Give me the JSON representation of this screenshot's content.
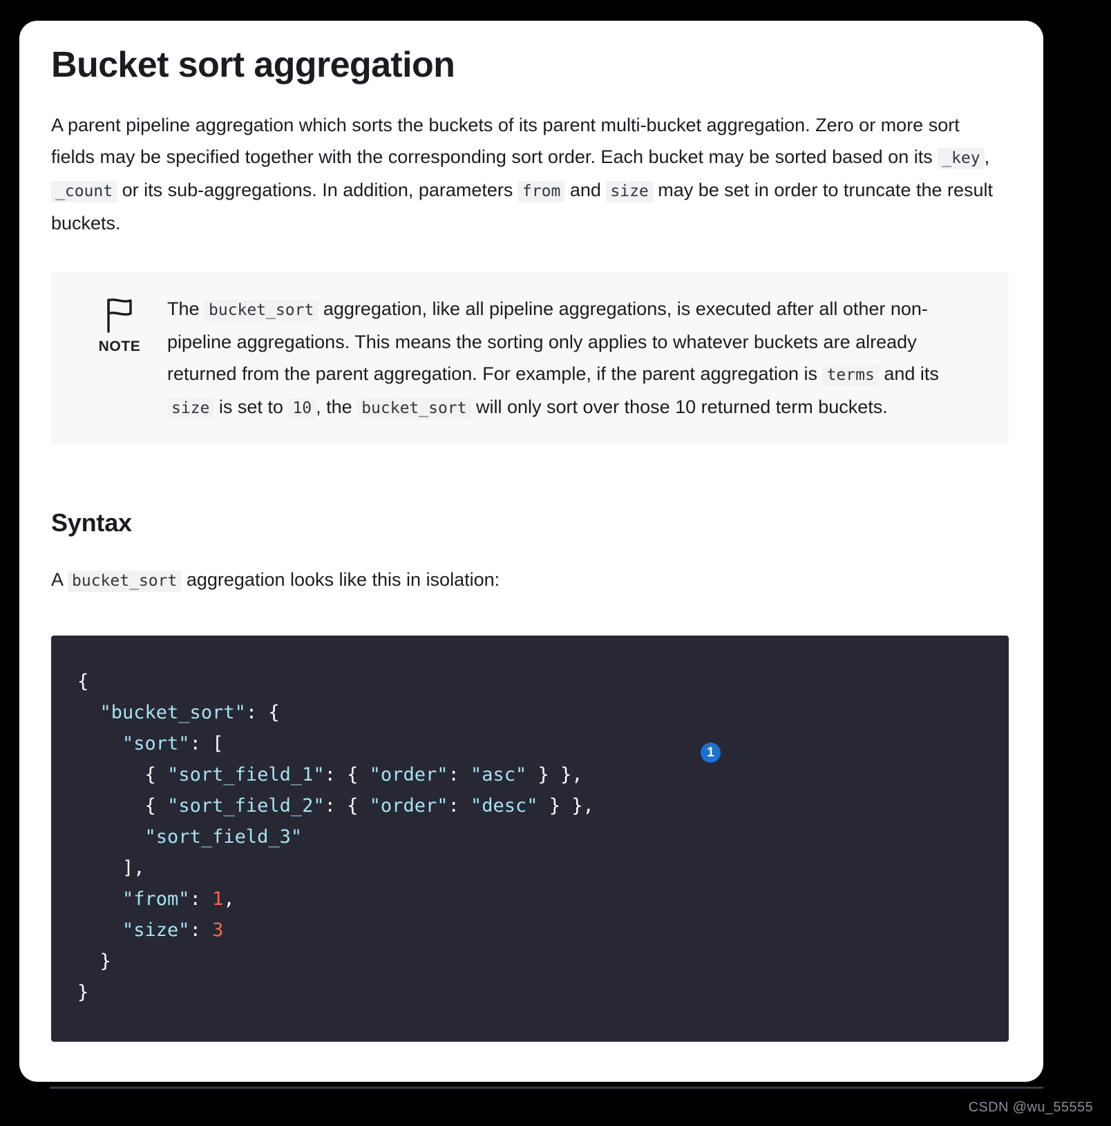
{
  "page": {
    "title": "Bucket sort aggregation"
  },
  "intro": {
    "seg1": "A parent pipeline aggregation which sorts the buckets of its parent multi-bucket aggregation. Zero or more sort fields may be specified together with the corresponding sort order. Each bucket may be sorted based on its ",
    "code1": "_key",
    "seg2": ", ",
    "code2": "_count",
    "seg3": " or its sub-aggregations. In addition, parameters ",
    "code3": "from",
    "seg4": " and ",
    "code4": "size",
    "seg5": " may be set in order to truncate the result buckets."
  },
  "note": {
    "icon": "flag-icon",
    "label": "NOTE",
    "seg1": "The ",
    "code1": "bucket_sort",
    "seg2": " aggregation, like all pipeline aggregations, is executed after all other non-pipeline aggregations. This means the sorting only applies to whatever buckets are already returned from the parent aggregation. For example, if the parent aggregation is ",
    "code2": "terms",
    "seg3": " and its ",
    "code3": "size",
    "seg4": " is set to ",
    "code4": "10",
    "seg5": ", the ",
    "code5": "bucket_sort",
    "seg6": " will only sort over those 10 returned term buckets."
  },
  "syntax": {
    "heading": "Syntax",
    "lead_seg1": "A ",
    "lead_code": "bucket_sort",
    "lead_seg2": " aggregation looks like this in isolation:"
  },
  "code_block": {
    "language": "json",
    "callout_badge": "1",
    "lines": [
      "{",
      "  \"bucket_sort\": {",
      "    \"sort\": [",
      "      { \"sort_field_1\": { \"order\": \"asc\" } },",
      "      { \"sort_field_2\": { \"order\": \"desc\" } },",
      "      \"sort_field_3\"",
      "    ],",
      "    \"from\": 1,",
      "    \"size\": 3",
      "  }",
      "}"
    ]
  },
  "watermark": {
    "text": "CSDN @wu_55555"
  },
  "colors": {
    "page_background": "#000000",
    "card_background": "#ffffff",
    "text": "#1a1c21",
    "inline_code_bg": "#f1f2f3",
    "note_bg": "#f7f8f9",
    "code_bg": "#272833",
    "code_string": "#a5e3f2",
    "code_number": "#f4664a",
    "badge_blue": "#1a73cf",
    "watermark": "#8d8f96"
  }
}
